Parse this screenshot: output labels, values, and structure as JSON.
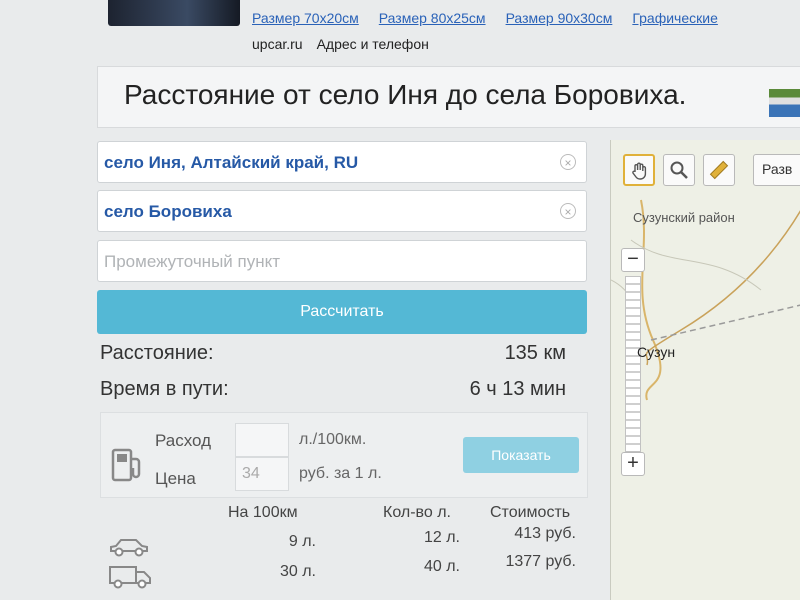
{
  "ad": {
    "links": [
      "Размер 70х20см",
      "Размер 80х25см",
      "Размер 90х30см",
      "Графические"
    ],
    "site": "upcar.ru",
    "contact_link": "Адрес и телефон"
  },
  "page_title": "Расстояние от село Иня до села Боровиха.",
  "route": {
    "from_value": "село Иня, Алтайский край, RU",
    "to_value": "село Боровиха",
    "via_placeholder": "Промежуточный пункт",
    "calculate_label": "Рассчитать"
  },
  "results": {
    "distance_label": "Расстояние:",
    "distance_value": "135 км",
    "time_label": "Время в пути:",
    "time_value": "6 ч 13 мин"
  },
  "fuel": {
    "consumption_label": "Расход",
    "consumption_unit": "л./100км.",
    "price_label": "Цена",
    "price_value": "34",
    "price_unit": "руб. за 1 л.",
    "show_label": "Показать"
  },
  "cost_table": {
    "headers": [
      "На 100км",
      "Кол-во л.",
      "Стоимость"
    ],
    "rows": [
      {
        "vehicle_icon": "car-icon",
        "per100": "9 л.",
        "liters": "12 л.",
        "cost": "413 руб."
      },
      {
        "vehicle_icon": "truck-icon",
        "per100": "30 л.",
        "liters": "40 л.",
        "cost": "1377 руб."
      }
    ]
  },
  "map": {
    "tools": [
      "hand-icon",
      "magnifier-icon",
      "ruler-icon"
    ],
    "layer_select": "Разв",
    "zoom_out": "−",
    "zoom_in": "+",
    "district_label": "Сузунский район",
    "town_label": "Сузун",
    "colors": {
      "road": "#d9b56a",
      "border": "#9a9a9a"
    }
  }
}
